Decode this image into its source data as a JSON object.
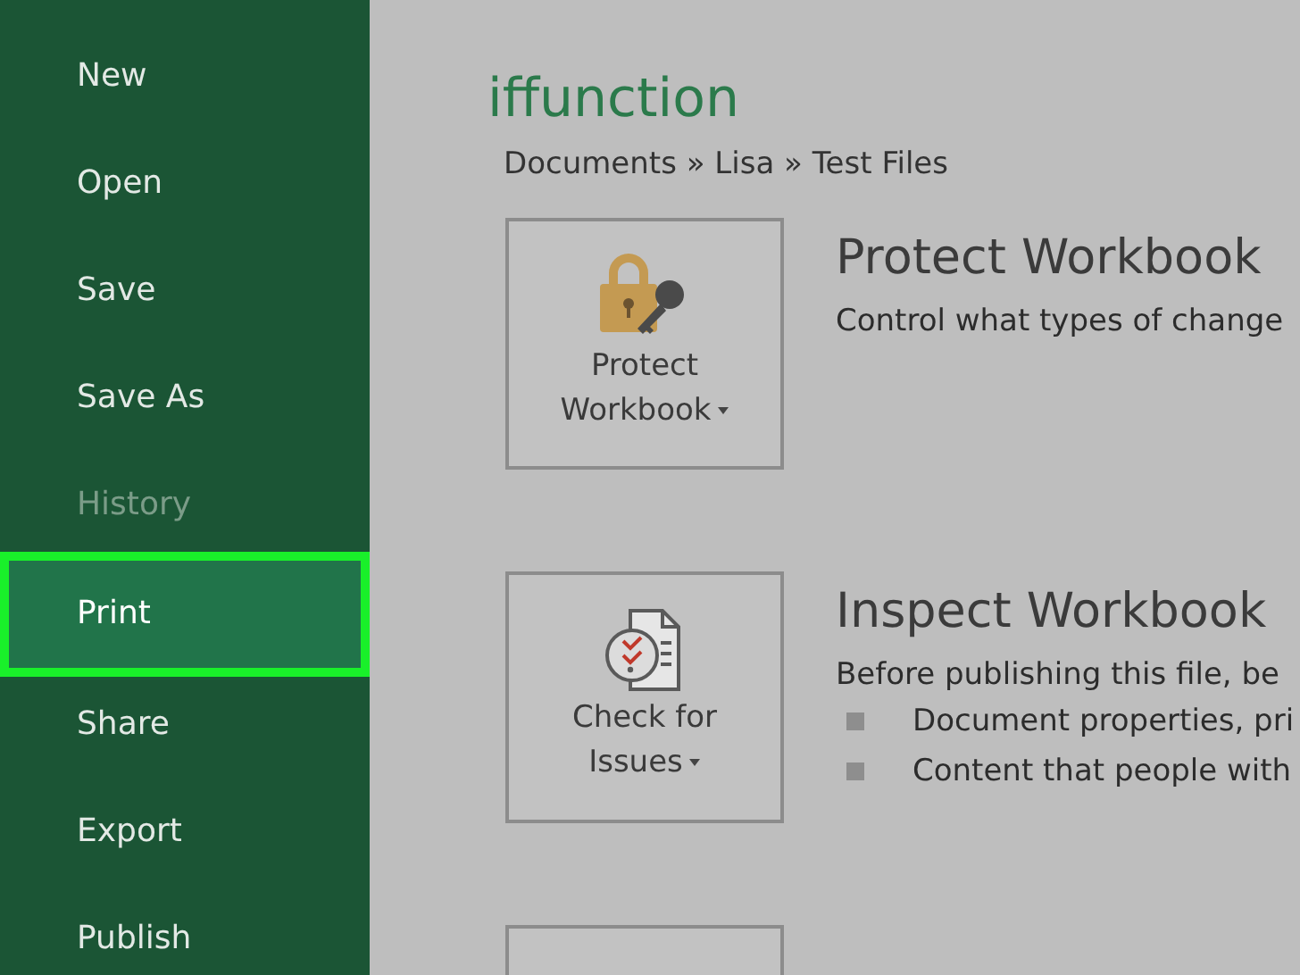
{
  "sidebar": {
    "items": [
      {
        "label": "New",
        "selected": false,
        "disabled": false
      },
      {
        "label": "Open",
        "selected": false,
        "disabled": false
      },
      {
        "label": "Save",
        "selected": false,
        "disabled": false
      },
      {
        "label": "Save As",
        "selected": false,
        "disabled": false
      },
      {
        "label": "History",
        "selected": false,
        "disabled": true
      },
      {
        "label": "Print",
        "selected": true,
        "disabled": false
      },
      {
        "label": "Share",
        "selected": false,
        "disabled": false
      },
      {
        "label": "Export",
        "selected": false,
        "disabled": false
      },
      {
        "label": "Publish",
        "selected": false,
        "disabled": false
      }
    ]
  },
  "main": {
    "title": "iffunction",
    "breadcrumb": "Documents » Lisa » Test Files",
    "sections": [
      {
        "kind": "lock",
        "button": [
          "Protect",
          "Workbook"
        ],
        "heading": "Protect Workbook",
        "description": "Control what types of change"
      },
      {
        "kind": "inspect",
        "button": [
          "Check for",
          "Issues"
        ],
        "heading": "Inspect Workbook",
        "description": "Before publishing this file, be",
        "bullets": [
          "Document properties, pri",
          "Content that people with"
        ]
      },
      {
        "kind": "blank"
      }
    ]
  }
}
